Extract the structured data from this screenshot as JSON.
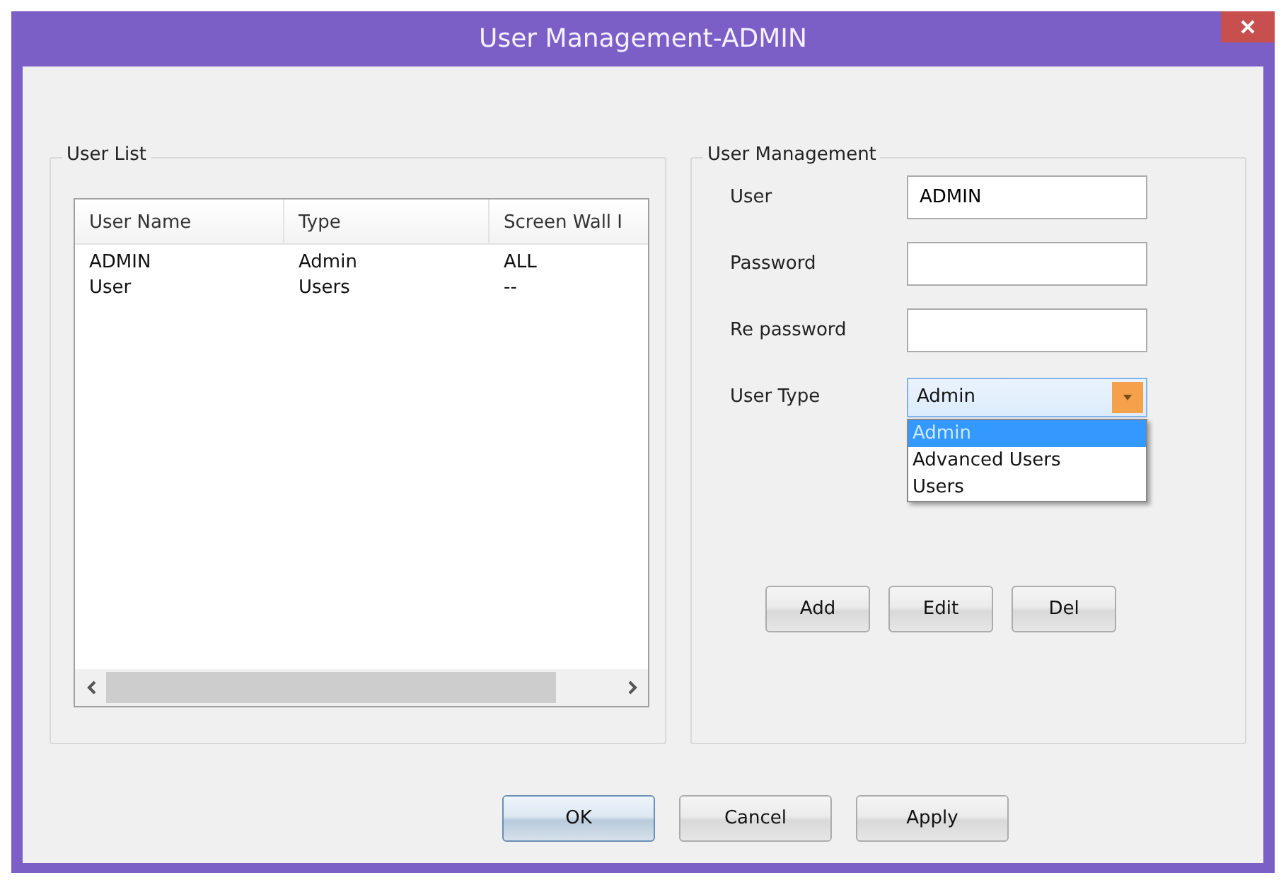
{
  "window": {
    "title": "User Management-ADMIN"
  },
  "user_list": {
    "legend": "User List",
    "columns": [
      "User Name",
      "Type",
      "Screen Wall I"
    ],
    "rows": [
      [
        "ADMIN",
        "Admin",
        "ALL"
      ],
      [
        "User",
        "Users",
        "--"
      ]
    ]
  },
  "user_management": {
    "legend": "User Management",
    "fields": [
      {
        "label": "User",
        "value": "ADMIN"
      },
      {
        "label": "Password"
      },
      {
        "label": "Re password"
      }
    ],
    "user_type": {
      "label": "User Type",
      "value": "Admin",
      "expanded": true,
      "options": [
        {
          "label": "Admin",
          "selected": true
        },
        {
          "label": "Advanced Users",
          "selected": false
        },
        {
          "label": "Users",
          "selected": false
        }
      ]
    },
    "buttons": [
      "Add",
      "Edit",
      "Del"
    ]
  },
  "buttons": [
    {
      "label": "OK",
      "default": true
    },
    {
      "label": "Cancel",
      "default": false
    },
    {
      "label": "Apply",
      "default": false
    }
  ]
}
